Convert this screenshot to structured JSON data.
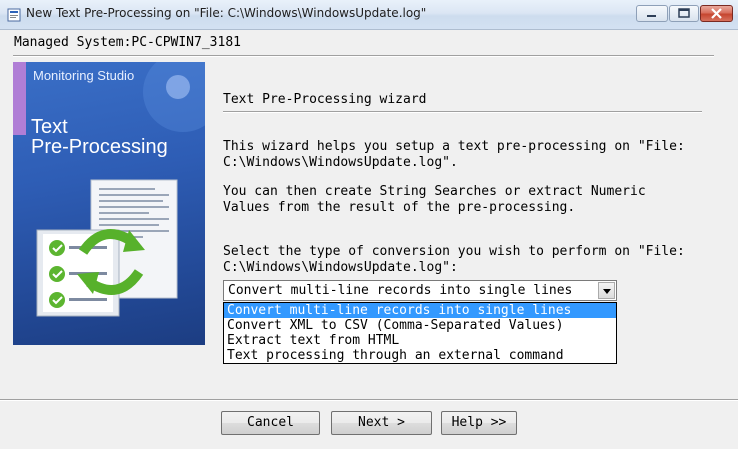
{
  "window": {
    "title": "New Text Pre-Processing on \"File: C:\\Windows\\WindowsUpdate.log\""
  },
  "managed_system": "Managed System:PC-CPWIN7_3181",
  "hero": {
    "brand": "Monitoring Studio",
    "title_line1": "Text",
    "title_line2": "Pre-Processing"
  },
  "wizard": {
    "section_title": "Text Pre-Processing wizard",
    "intro_line1": "This wizard helps you setup a text pre-processing on \"File:",
    "intro_line2": "C:\\Windows\\WindowsUpdate.log\".",
    "info_line1": "You can then create String Searches or extract Numeric",
    "info_line2": "Values from the result of the pre-processing.",
    "select_prompt_line1": "Select the type of conversion you wish to perform on \"File:",
    "select_prompt_line2": "C:\\Windows\\WindowsUpdate.log\":"
  },
  "conversion_select": {
    "value": "Convert multi-line records into single lines",
    "options": [
      "Convert multi-line records into single lines",
      "Convert XML to CSV (Comma-Separated Values)",
      "Extract text from HTML",
      "Text processing through an external command"
    ]
  },
  "buttons": {
    "cancel": "Cancel",
    "next": "Next >",
    "help": "Help >>"
  }
}
